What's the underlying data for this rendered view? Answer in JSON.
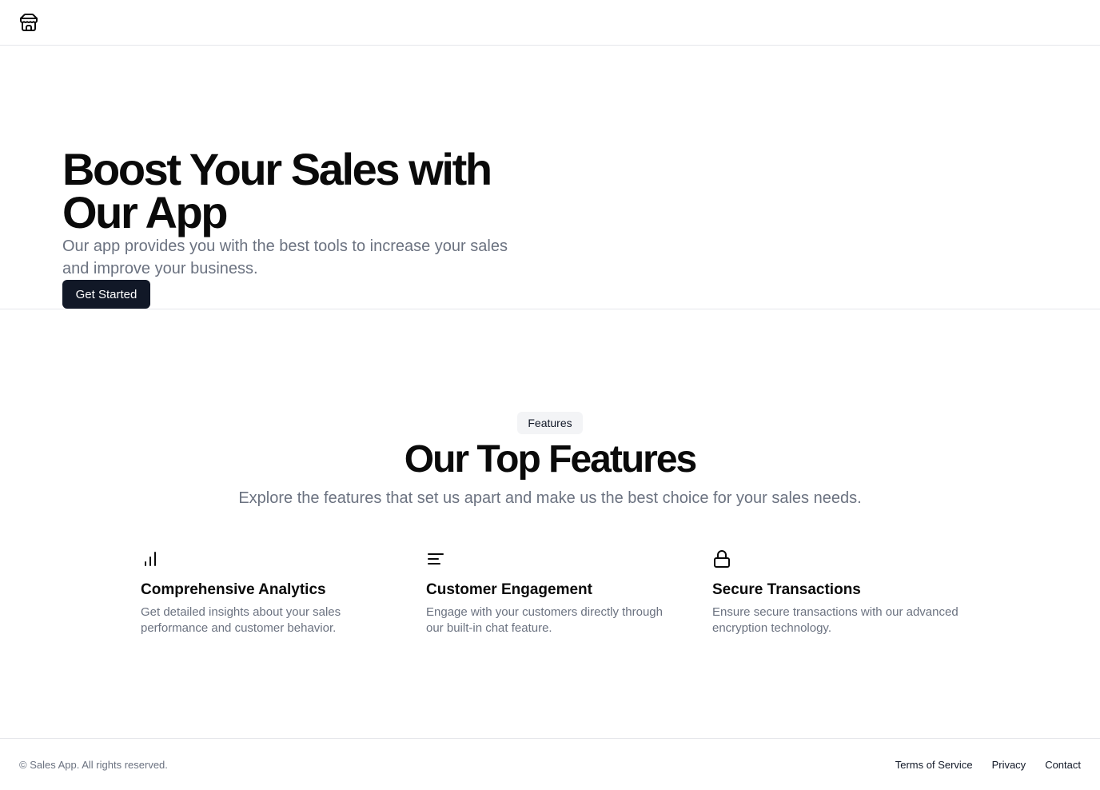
{
  "header": {
    "logo_icon": "store-icon"
  },
  "hero": {
    "title": "Boost Your Sales with Our App",
    "subtitle": "Our app provides you with the best tools to increase your sales and improve your business.",
    "cta_label": "Get Started"
  },
  "features": {
    "badge": "Features",
    "title": "Our Top Features",
    "subtitle": "Explore the features that set us apart and make us the best choice for your sales needs.",
    "items": [
      {
        "icon": "bar-chart-icon",
        "title": "Comprehensive Analytics",
        "description": "Get detailed insights about your sales performance and customer behavior."
      },
      {
        "icon": "align-left-icon",
        "title": "Customer Engagement",
        "description": "Engage with your customers directly through our built-in chat feature."
      },
      {
        "icon": "lock-icon",
        "title": "Secure Transactions",
        "description": "Ensure secure transactions with our advanced encryption technology."
      }
    ]
  },
  "footer": {
    "copyright": "© Sales App. All rights reserved.",
    "links": [
      "Terms of Service",
      "Privacy",
      "Contact"
    ]
  },
  "colors": {
    "primary_button": "#111827",
    "muted_text": "#6b7280",
    "border": "#e5e7eb",
    "badge_bg": "#f3f4f6"
  }
}
